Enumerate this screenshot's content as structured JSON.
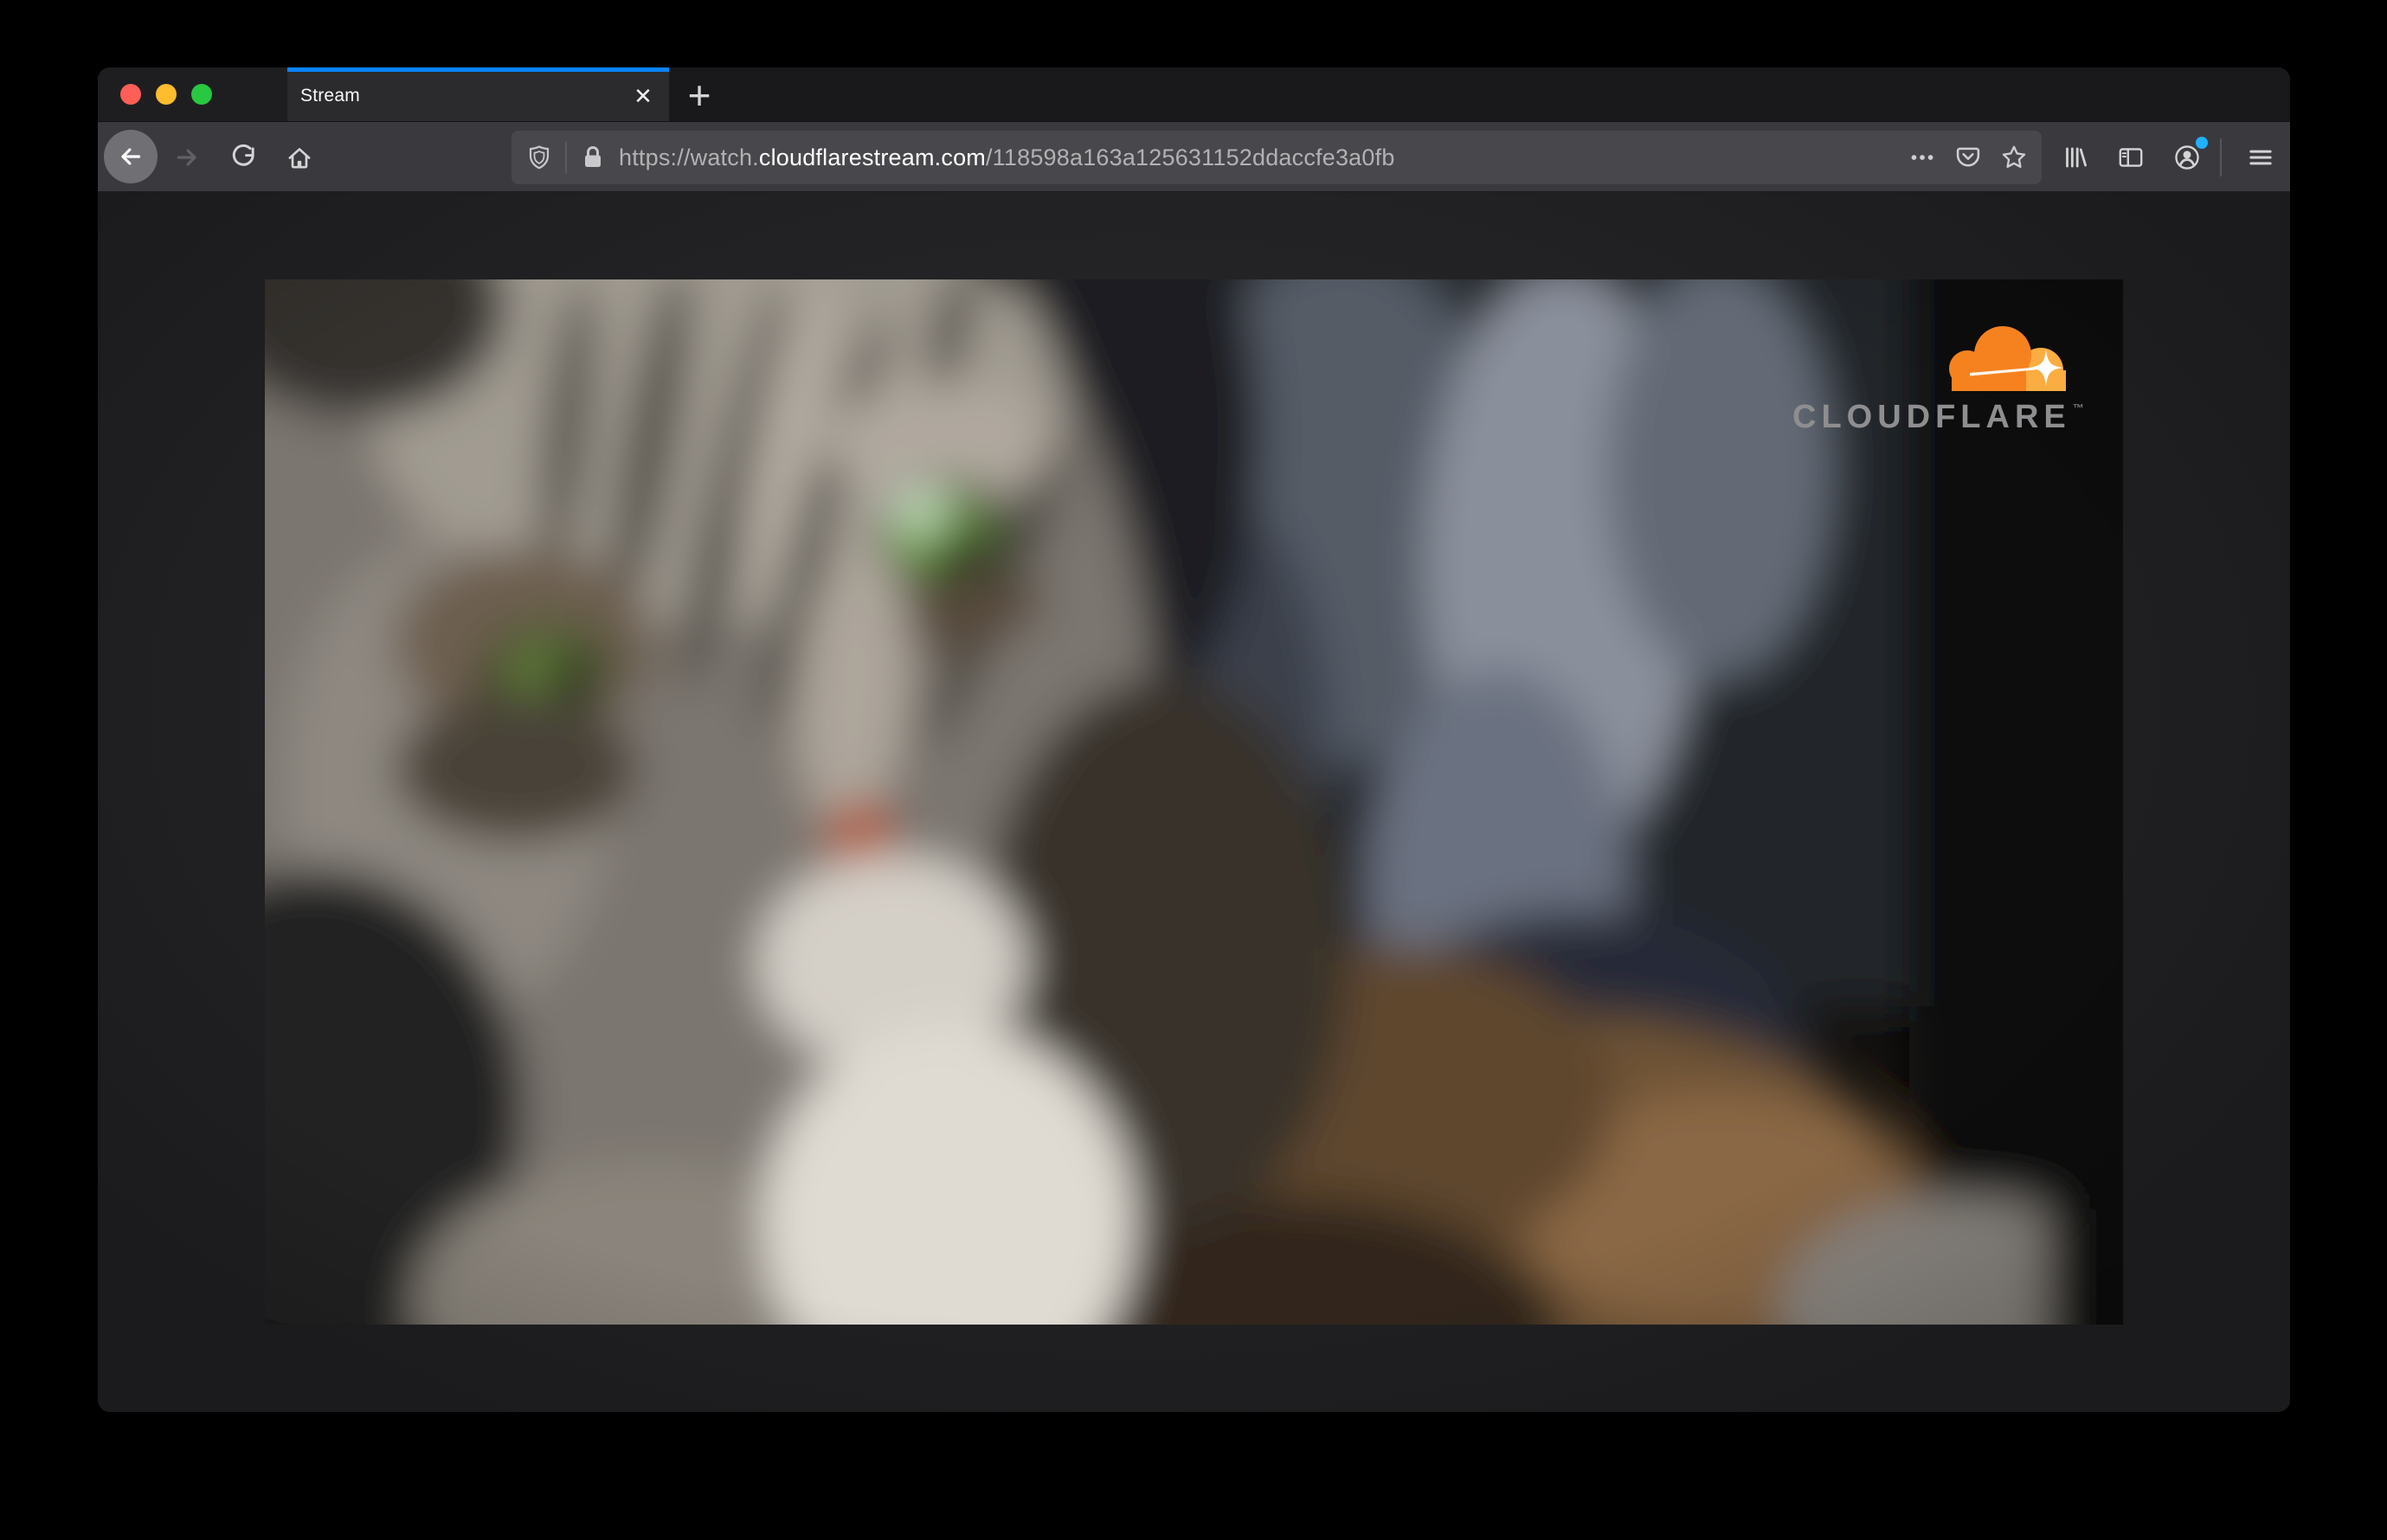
{
  "window": {
    "traffic_lights": {
      "close_color": "#ff5f57",
      "minimize_color": "#febc2e",
      "zoom_color": "#28c840"
    }
  },
  "tab": {
    "title": "Stream",
    "active": true,
    "accent_stripe_color": "#0a84ff"
  },
  "icons": {
    "tab_close": "✕",
    "new_tab": "+",
    "back": "arrow-left-circle",
    "forward": "arrow-right",
    "reload": "refresh-arc",
    "home": "house",
    "tracking_protection": "shield",
    "connection_secure": "lock",
    "page_actions": "three-dots",
    "pocket": "pocket-chevron",
    "bookmark": "star-outline",
    "library": "books",
    "sidebar": "split-panel",
    "account": "person-circle",
    "menu": "hamburger"
  },
  "urlbar": {
    "scheme": "https://watch.",
    "domain": "cloudflarestream.com",
    "path": "/118598a163a125631152ddaccfe3a0fb"
  },
  "account": {
    "notification_dot_color": "#1fb1fd"
  },
  "theme": {
    "tabbar_bg": "#19191c",
    "active_tab_bg": "#2b2b2e",
    "toolbar_bg": "#3a3a3e",
    "urlbar_bg": "#48484c",
    "content_bg": "#232325",
    "icon_color": "#d4d4d6",
    "url_dim_text": "#b2b2b4",
    "url_domain_text": "#ffffff"
  },
  "video": {
    "description": "out-of-focus close-up of a gray tabby cat with green eyes, white chest, brown blurred foreground, blue-gray blurred background",
    "brand": {
      "wordmark": "CLOUDFLARE",
      "trademark": "™",
      "cloud_orange": "#f6821f",
      "cloud_light_orange": "#fbad41",
      "wordmark_color": "#8e8e90"
    }
  }
}
